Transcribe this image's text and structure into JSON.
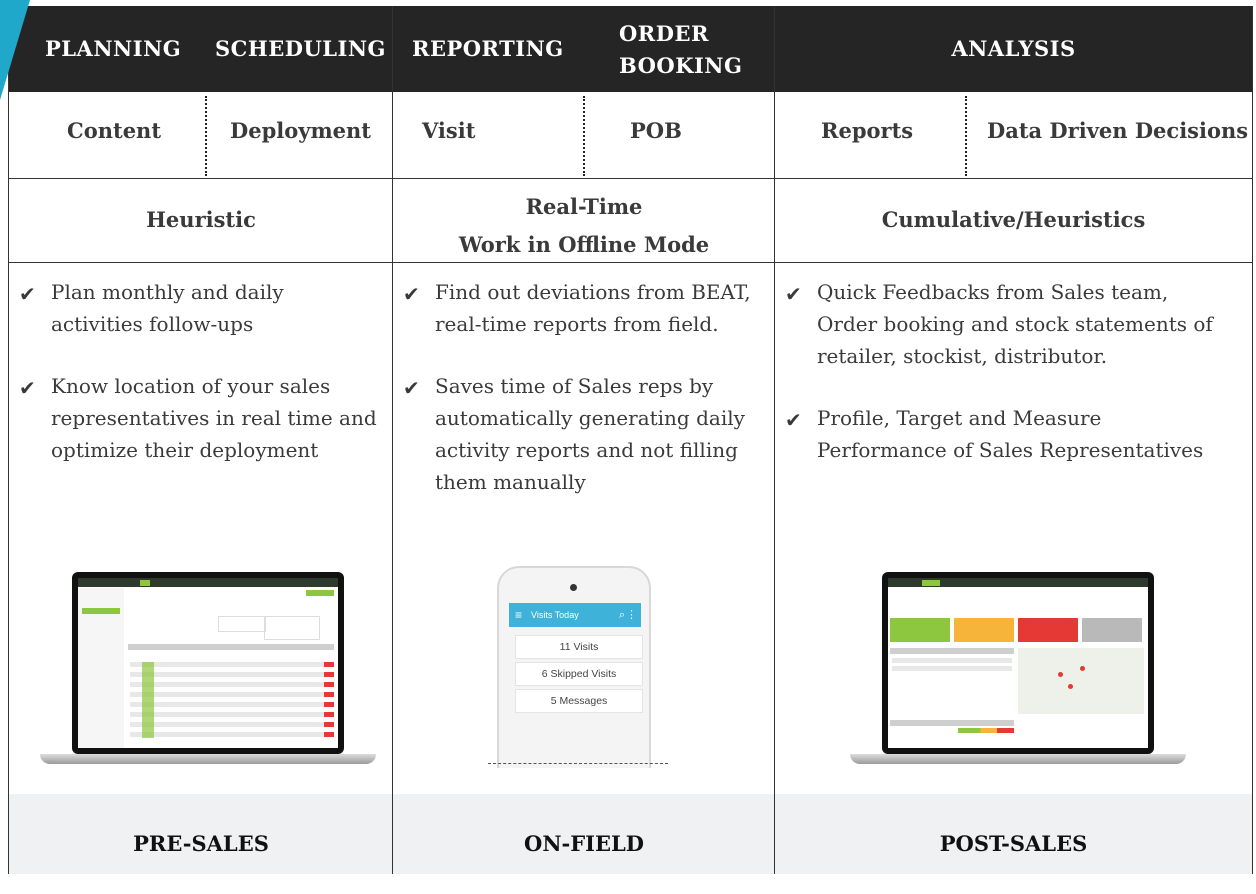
{
  "columns": [
    {
      "header_left": "PLANNING",
      "header_right": "SCHEDULING",
      "sub_left": "Content",
      "sub_right": "Deployment",
      "mode_line1": "Heuristic",
      "mode_line2": "",
      "bullets": [
        "Plan monthly and daily activities follow-ups",
        "Know location of your sales representatives in real time and optimize their deployment"
      ],
      "footer": "PRE-SALES"
    },
    {
      "header_left": "REPORTING",
      "header_right": "ORDER BOOKING",
      "sub_left": "Visit",
      "sub_right": "POB",
      "mode_line1": "Real-Time",
      "mode_line2": "Work in Offline Mode",
      "bullets": [
        "Find out deviations from BEAT, real-time reports from field.",
        "Saves time of Sales reps by automatically generating daily activity reports and not filling them manually"
      ],
      "footer": "ON-FIELD"
    },
    {
      "header_center": "ANALYSIS",
      "sub_left": "Reports",
      "sub_right": "Data Driven Decisions",
      "mode_line1": "Cumulative/Heuristics",
      "mode_line2": "",
      "bullets": [
        "Quick Feedbacks from Sales team, Order booking and stock statements of retailer, stockist, distributor.",
        "Profile, Target and Measure Performance of Sales Representatives"
      ],
      "footer": "POST-SALES"
    }
  ],
  "phone": {
    "title": "Visits Today",
    "cards": [
      "11 Visits",
      "6 Skipped Visits",
      "5 Messages"
    ]
  },
  "icons": {
    "check": "checkmark-icon",
    "menu": "hamburger-icon",
    "search": "search-icon",
    "more": "more-vertical-icon"
  },
  "colors": {
    "header_bg": "#252525",
    "footer_bg": "#f0f1f2",
    "accent": "#1fa8c9",
    "phone_bar": "#3eb2d8",
    "app_green": "#8dc63f"
  }
}
